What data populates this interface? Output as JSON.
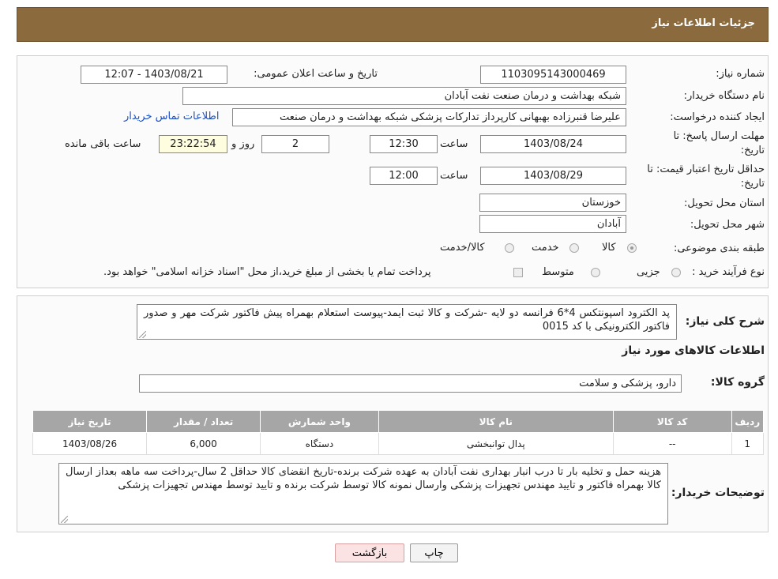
{
  "header": {
    "title": "جزئیات اطلاعات نیاز"
  },
  "form": {
    "need_number_label": "شماره نیاز:",
    "need_number": "1103095143000469",
    "announce_label": "تاریخ و ساعت اعلان عمومی:",
    "announce_value": "1403/08/21 - 12:07",
    "buyer_org_label": "نام دستگاه خریدار:",
    "buyer_org": "شبکه بهداشت و درمان صنعت نفت آبادان",
    "creator_label": "ایجاد کننده درخواست:",
    "creator": "علیرضا قنبرزاده بهبهانی کارپرداز تدارکات پزشکی شبکه بهداشت و درمان صنعت",
    "contact_link": "اطلاعات تماس خریدار",
    "deadline_label": "مهلت ارسال پاسخ: تا تاریخ:",
    "deadline_date": "1403/08/24",
    "time_label": "ساعت",
    "deadline_time": "12:30",
    "days_value": "2",
    "days_label": "روز و",
    "remaining_value": "23:22:54",
    "remaining_label": "ساعت باقی مانده",
    "validity_label": "حداقل تاریخ اعتبار قیمت: تا تاریخ:",
    "validity_date": "1403/08/29",
    "validity_time": "12:00",
    "province_label": "استان محل تحویل:",
    "province": "خوزستان",
    "city_label": "شهر محل تحویل:",
    "city": "آبادان",
    "category_label": "طبقه بندی موضوعی:",
    "category_options": [
      "کالا",
      "خدمت",
      "کالا/خدمت"
    ],
    "process_label": "نوع فرآیند خرید :",
    "process_options": [
      "جزیی",
      "متوسط"
    ],
    "process_note": "پرداخت تمام یا بخشی از مبلغ خرید،از محل \"اسناد خزانه اسلامی\" خواهد بود."
  },
  "summary": {
    "label": "شرح کلی نیاز:",
    "text": "پد الکترود اسپونتکس 4*6 فرانسه دو لایه -شرکت و کالا ثبت ایمد-پیوست استعلام بهمراه پیش فاکتور شرکت مهر و صدور فاکتور الکترونیکی با کد 0015",
    "items_title": "اطلاعات کالاهای مورد نیاز",
    "group_label": "گروه کالا:",
    "group_value": "دارو، پزشکی و سلامت"
  },
  "table": {
    "headers": [
      "ردیف",
      "کد کالا",
      "نام کالا",
      "واحد شمارش",
      "تعداد / مقدار",
      "تاریخ نیاز"
    ],
    "rows": [
      [
        "1",
        "--",
        "پدال توانبخشی",
        "دستگاه",
        "6,000",
        "1403/08/26"
      ]
    ]
  },
  "buyer_notes": {
    "label": "توضیحات خریدار:",
    "text": "هزینه حمل و تخلیه بار تا درب انبار بهداری نفت آبادان به عهده شرکت برنده-تاریخ انقضای کالا حداقل 2 سال-پرداخت سه ماهه بعداز ارسال کالا بهمراه فاکتور و تایید مهندس تجهیزات پزشکی وارسال نمونه کالا توسط شرکت برنده و تایید توسط مهندس تجهیزات پزشکی"
  },
  "buttons": {
    "print": "چاپ",
    "back": "بازگشت"
  },
  "colors": {
    "header_bg": "#8b6a3e",
    "table_header_bg": "#a6a6a6",
    "link": "#1a4fc4",
    "back_bg": "#fbe3e3"
  }
}
